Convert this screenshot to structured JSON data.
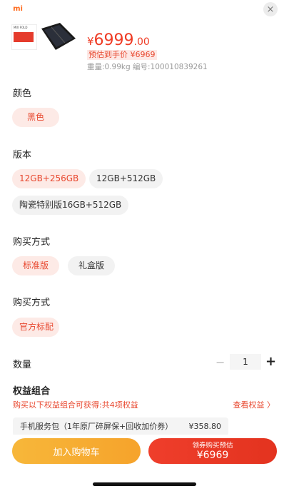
{
  "header": {
    "logo_text": "mi",
    "close_icon": "×"
  },
  "product": {
    "thumb_text": "MIX FOLD",
    "price_currency": "¥",
    "price_main": "6999",
    "price_decimal": ".00",
    "estimated": "预估到手价 ¥6969",
    "meta": "重量:0.99kg  编号:100010839261"
  },
  "sections": {
    "color_title": "颜色",
    "version_title": "版本",
    "buy_title_1": "购买方式",
    "buy_title_2": "购买方式"
  },
  "options": {
    "color": [
      "黑色"
    ],
    "version": [
      "12GB+256GB",
      "12GB+512GB",
      "陶瓷特别版16GB+512GB"
    ],
    "buy_mode": [
      "标准版",
      "礼盒版"
    ],
    "buy_mode_2": [
      "官方标配"
    ]
  },
  "quantity": {
    "label": "数量",
    "minus": "−",
    "value": "1",
    "plus": "+"
  },
  "benefits": {
    "title": "权益组合",
    "note": "购买以下权益组合可获得:共4项权益",
    "view_link": "查看权益 〉",
    "item_label": "手机服务包（1年原厂碎屏保+回收加价券）",
    "item_price": "¥358.80"
  },
  "actions": {
    "cart": "加入购物车",
    "buy_line1": "领券购买预估",
    "buy_line2": "¥6969"
  },
  "colors": {
    "accent": "#e8472e",
    "chip_selected_bg": "#fdeae6",
    "cart_bg": "#f6a32b",
    "buy_bg": "#e3331f"
  }
}
